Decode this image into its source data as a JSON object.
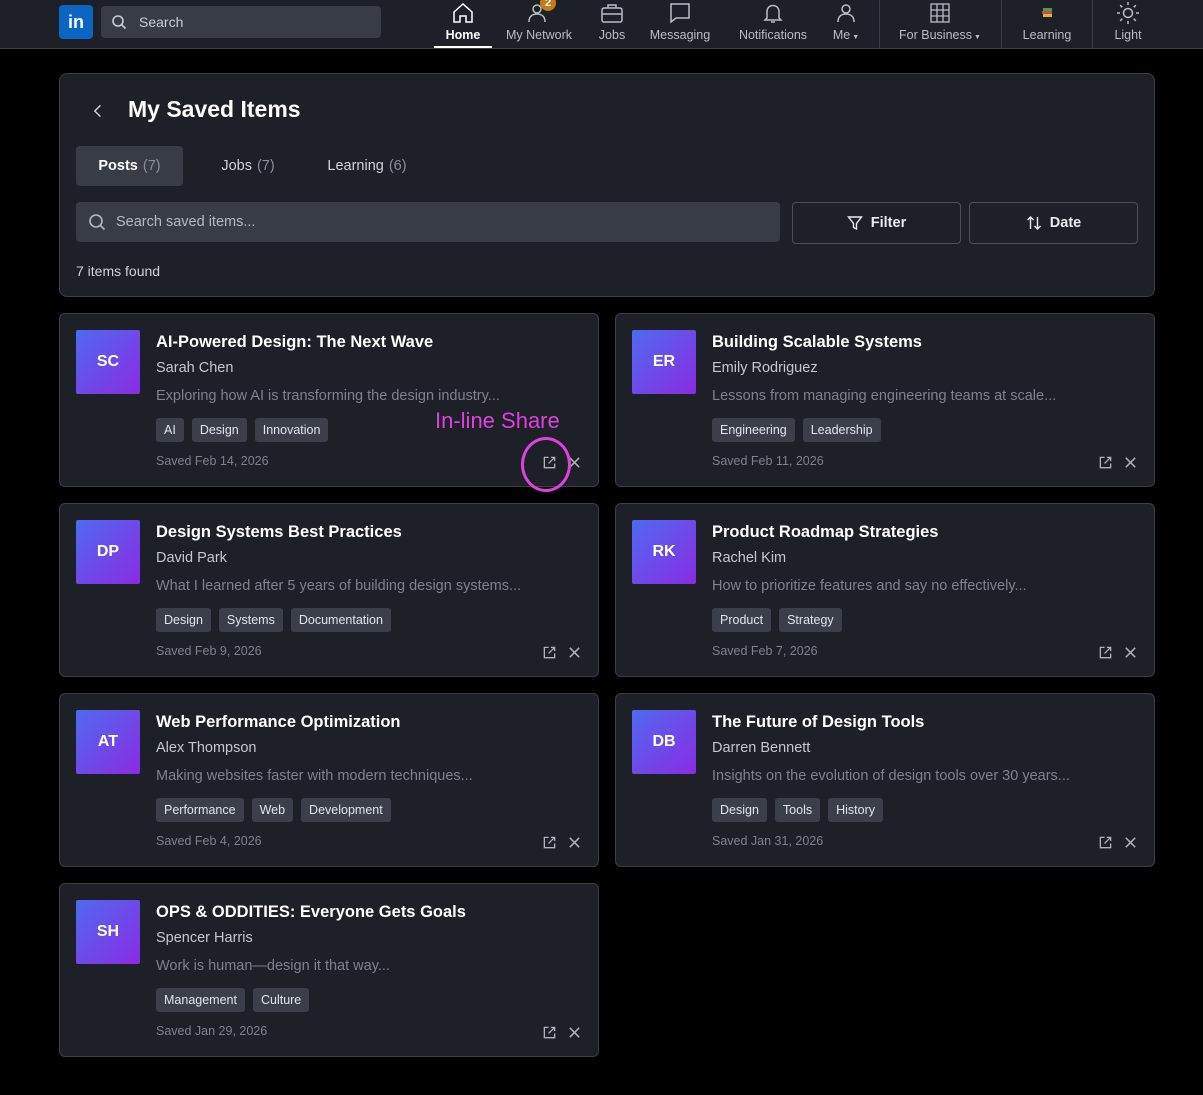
{
  "nav": {
    "logo": "in",
    "search_placeholder": "Search",
    "items": [
      {
        "label": "Home",
        "icon": "home-icon",
        "active": true
      },
      {
        "label": "My Network",
        "icon": "people-icon",
        "badge": "2"
      },
      {
        "label": "Jobs",
        "icon": "briefcase-icon"
      },
      {
        "label": "Messaging",
        "icon": "message-icon"
      },
      {
        "label": "Notifications",
        "icon": "bell-icon"
      },
      {
        "label": "Me",
        "icon": "person-icon"
      },
      {
        "label": "For Business",
        "icon": "grid-icon"
      },
      {
        "label": "Learning",
        "icon": "books-icon"
      },
      {
        "label": "Light",
        "icon": "sun-icon"
      }
    ]
  },
  "page": {
    "title": "My Saved Items",
    "tabs": [
      {
        "label": "Posts",
        "count": "(7)",
        "active": true
      },
      {
        "label": "Jobs",
        "count": "(7)"
      },
      {
        "label": "Learning",
        "count": "(6)"
      }
    ],
    "search_placeholder": "Search saved items...",
    "filter_label": "Filter",
    "sort_label": "Date",
    "results_text": "7 items found"
  },
  "items": [
    {
      "initials": "SC",
      "title": "AI-Powered Design: The Next Wave",
      "author": "Sarah Chen",
      "desc": "Exploring how AI is transforming the design industry...",
      "tags": [
        "AI",
        "Design",
        "Innovation"
      ],
      "saved": "Saved Feb 14, 2026"
    },
    {
      "initials": "ER",
      "title": "Building Scalable Systems",
      "author": "Emily Rodriguez",
      "desc": "Lessons from managing engineering teams at scale...",
      "tags": [
        "Engineering",
        "Leadership"
      ],
      "saved": "Saved Feb 11, 2026"
    },
    {
      "initials": "DP",
      "title": "Design Systems Best Practices",
      "author": "David Park",
      "desc": "What I learned after 5 years of building design systems...",
      "tags": [
        "Design",
        "Systems",
        "Documentation"
      ],
      "saved": "Saved Feb 9, 2026"
    },
    {
      "initials": "RK",
      "title": "Product Roadmap Strategies",
      "author": "Rachel Kim",
      "desc": "How to prioritize features and say no effectively...",
      "tags": [
        "Product",
        "Strategy"
      ],
      "saved": "Saved Feb 7, 2026"
    },
    {
      "initials": "AT",
      "title": "Web Performance Optimization",
      "author": "Alex Thompson",
      "desc": "Making websites faster with modern techniques...",
      "tags": [
        "Performance",
        "Web",
        "Development"
      ],
      "saved": "Saved Feb 4, 2026"
    },
    {
      "initials": "DB",
      "title": "The Future of Design Tools",
      "author": "Darren Bennett",
      "desc": "Insights on the evolution of design tools over 30 years...",
      "tags": [
        "Design",
        "Tools",
        "History"
      ],
      "saved": "Saved Jan 31, 2026"
    },
    {
      "initials": "SH",
      "title": "OPS & ODDITIES: Everyone Gets Goals",
      "author": "Spencer Harris",
      "desc": "Work is human—design it that way...",
      "tags": [
        "Management",
        "Culture"
      ],
      "saved": "Saved Jan 29, 2026"
    }
  ],
  "annotation": {
    "text": "In-line Share"
  },
  "colors": {
    "accent_annotation": "#e040e0",
    "avatar_gradient_start": "#4f6af0",
    "avatar_gradient_end": "#8a2be2",
    "linkedin_blue": "#0a66c2",
    "badge": "#c37d16"
  }
}
